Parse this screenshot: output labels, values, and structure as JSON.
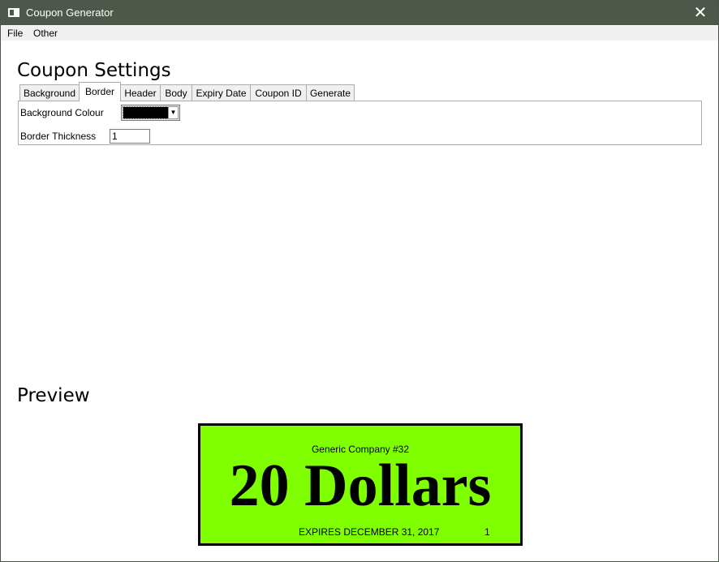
{
  "window": {
    "title": "Coupon Generator",
    "close_glyph": "✕",
    "icon": "app-window-icon"
  },
  "menu": {
    "items": [
      "File",
      "Other"
    ]
  },
  "settings": {
    "title": "Coupon Settings",
    "tabs": [
      "Background",
      "Border",
      "Header",
      "Body",
      "Expiry Date",
      "Coupon ID",
      "Generate"
    ],
    "active_tab": "Border",
    "border": {
      "colour_label": "Background Colour",
      "colour_value": "#000000",
      "thickness_label": "Border Thickness",
      "thickness_value": "1"
    }
  },
  "preview": {
    "title": "Preview",
    "coupon": {
      "background": "#7fff00",
      "border_colour": "#000000",
      "company": "Generic Company #32",
      "amount": "20 Dollars",
      "expiry": "EXPIRES DECEMBER 31, 2017",
      "id": "1"
    }
  },
  "colors": {
    "titlebar": "#4d584b",
    "menubar": "#f0f0f0"
  }
}
